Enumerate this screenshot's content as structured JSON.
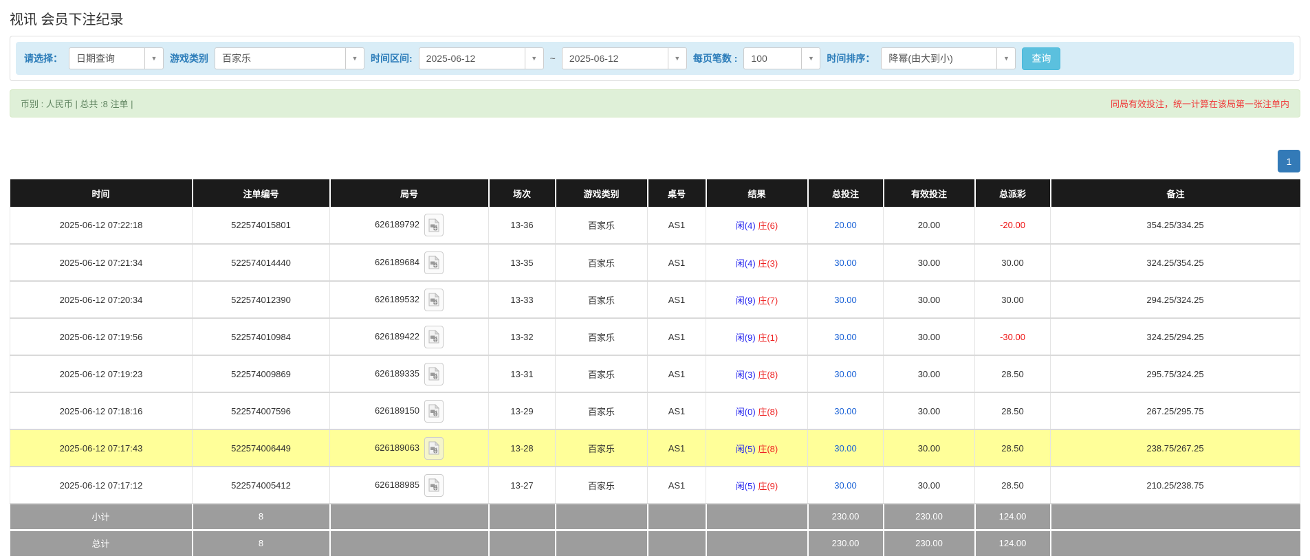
{
  "page": {
    "title": "视讯 会员下注纪录"
  },
  "filters": {
    "select_label": "请选择：",
    "select_value": "日期查询",
    "game_type_label": "游戏类别",
    "game_type_value": "百家乐",
    "date_range_label": "时间区间:",
    "date_from": "2025-06-12",
    "tilde": "~",
    "date_to": "2025-06-12",
    "page_size_label": "每页笔数 :",
    "page_size_value": "100",
    "sort_label": "时间排序：",
    "sort_value": "降幂(由大到小)",
    "search_button": "查询"
  },
  "summary": {
    "left_text": "币别 : 人民币 | 总共 :8 注单 |",
    "right_notice": "同局有效投注，统一计算在该局第一张注单内"
  },
  "pagination": {
    "current": "1"
  },
  "colors": {
    "filter_bar_bg": "#d9edf7",
    "filter_label_blue": "#2b7cb9",
    "search_button_bg": "#5bc0de",
    "summary_bg": "#dff0d8",
    "notice_red": "#f03b3b",
    "table_header_bg": "#1b1b1b",
    "table_footer_bg": "#9d9d9d",
    "highlight_row_bg": "#ffff99",
    "pagination_bg": "#337ab7",
    "player_blue": "#2222ee",
    "banker_red": "#ee2222",
    "amount_link_blue": "#1a62d6",
    "negative_red": "#ee1111"
  },
  "table": {
    "headers": [
      "时间",
      "注单编号",
      "局号",
      "场次",
      "游戏类别",
      "桌号",
      "结果",
      "总投注",
      "有效投注",
      "总派彩",
      "备注"
    ],
    "rows": [
      {
        "time": "2025-06-12 07:22:18",
        "bet_id": "522574015801",
        "round": "626189792",
        "session": "13-36",
        "game": "百家乐",
        "table_no": "AS1",
        "result_player": "闲(4)",
        "result_banker": "庄(6)",
        "total_bet": "20.00",
        "valid_bet": "20.00",
        "payout": "-20.00",
        "remark": "354.25/334.25",
        "highlight": false
      },
      {
        "time": "2025-06-12 07:21:34",
        "bet_id": "522574014440",
        "round": "626189684",
        "session": "13-35",
        "game": "百家乐",
        "table_no": "AS1",
        "result_player": "闲(4)",
        "result_banker": "庄(3)",
        "total_bet": "30.00",
        "valid_bet": "30.00",
        "payout": "30.00",
        "remark": "324.25/354.25",
        "highlight": false
      },
      {
        "time": "2025-06-12 07:20:34",
        "bet_id": "522574012390",
        "round": "626189532",
        "session": "13-33",
        "game": "百家乐",
        "table_no": "AS1",
        "result_player": "闲(9)",
        "result_banker": "庄(7)",
        "total_bet": "30.00",
        "valid_bet": "30.00",
        "payout": "30.00",
        "remark": "294.25/324.25",
        "highlight": false
      },
      {
        "time": "2025-06-12 07:19:56",
        "bet_id": "522574010984",
        "round": "626189422",
        "session": "13-32",
        "game": "百家乐",
        "table_no": "AS1",
        "result_player": "闲(9)",
        "result_banker": "庄(1)",
        "total_bet": "30.00",
        "valid_bet": "30.00",
        "payout": "-30.00",
        "remark": "324.25/294.25",
        "highlight": false
      },
      {
        "time": "2025-06-12 07:19:23",
        "bet_id": "522574009869",
        "round": "626189335",
        "session": "13-31",
        "game": "百家乐",
        "table_no": "AS1",
        "result_player": "闲(3)",
        "result_banker": "庄(8)",
        "total_bet": "30.00",
        "valid_bet": "30.00",
        "payout": "28.50",
        "remark": "295.75/324.25",
        "highlight": false
      },
      {
        "time": "2025-06-12 07:18:16",
        "bet_id": "522574007596",
        "round": "626189150",
        "session": "13-29",
        "game": "百家乐",
        "table_no": "AS1",
        "result_player": "闲(0)",
        "result_banker": "庄(8)",
        "total_bet": "30.00",
        "valid_bet": "30.00",
        "payout": "28.50",
        "remark": "267.25/295.75",
        "highlight": false
      },
      {
        "time": "2025-06-12 07:17:43",
        "bet_id": "522574006449",
        "round": "626189063",
        "session": "13-28",
        "game": "百家乐",
        "table_no": "AS1",
        "result_player": "闲(5)",
        "result_banker": "庄(8)",
        "total_bet": "30.00",
        "valid_bet": "30.00",
        "payout": "28.50",
        "remark": "238.75/267.25",
        "highlight": true
      },
      {
        "time": "2025-06-12 07:17:12",
        "bet_id": "522574005412",
        "round": "626188985",
        "session": "13-27",
        "game": "百家乐",
        "table_no": "AS1",
        "result_player": "闲(5)",
        "result_banker": "庄(9)",
        "total_bet": "30.00",
        "valid_bet": "30.00",
        "payout": "28.50",
        "remark": "210.25/238.75",
        "highlight": false
      }
    ],
    "subtotal": {
      "label": "小计",
      "count": "8",
      "total_bet": "230.00",
      "valid_bet": "230.00",
      "payout": "124.00"
    },
    "total": {
      "label": "总计",
      "count": "8",
      "total_bet": "230.00",
      "valid_bet": "230.00",
      "payout": "124.00"
    }
  }
}
